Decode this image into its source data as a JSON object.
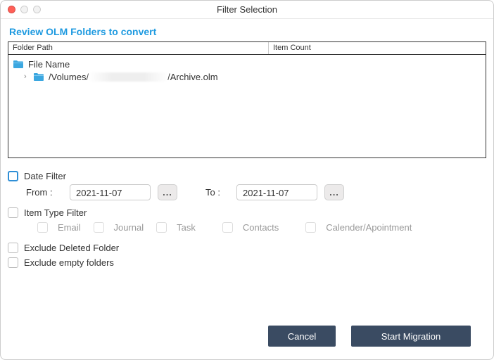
{
  "window": {
    "title": "Filter Selection"
  },
  "section_title": "Review OLM Folders to convert",
  "tree": {
    "headers": {
      "path": "Folder Path",
      "count": "Item Count"
    },
    "root_label": "File Name",
    "item": {
      "prefix": "/Volumes/",
      "suffix": "/Archive.olm"
    }
  },
  "filters": {
    "date_filter_label": "Date Filter",
    "from_label": "From :",
    "to_label": "To :",
    "from_value": "2021-11-07",
    "to_value": "2021-11-07",
    "picker_glyph": "...",
    "item_type_label": "Item Type Filter",
    "types": {
      "email": "Email",
      "journal": "Journal",
      "task": "Task",
      "contacts": "Contacts",
      "calendar": "Calender/Apointment"
    },
    "exclude_deleted": "Exclude Deleted Folder",
    "exclude_empty": "Exclude empty folders"
  },
  "buttons": {
    "cancel": "Cancel",
    "start": "Start Migration"
  }
}
